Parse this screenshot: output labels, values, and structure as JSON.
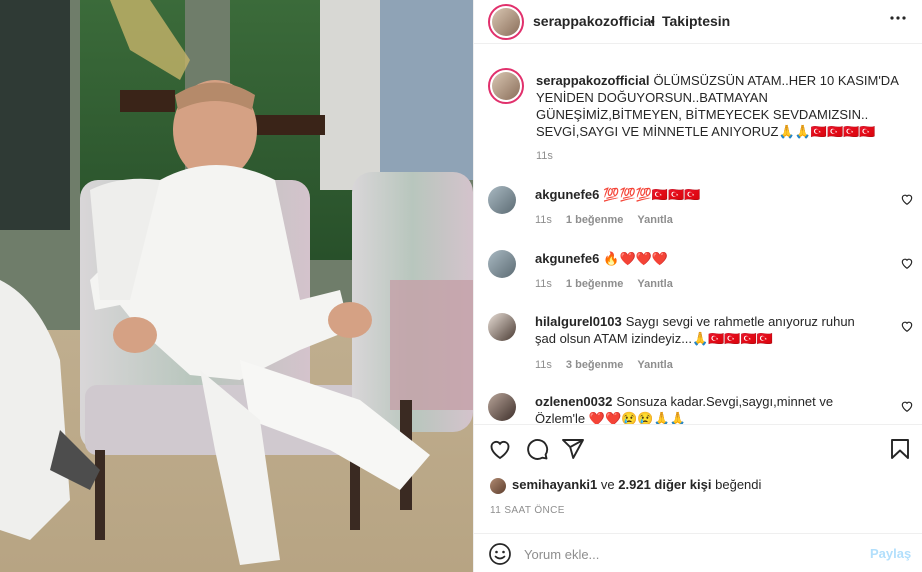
{
  "post": {
    "author": "serappakozofficial",
    "follow_status": "Takiptesin",
    "separator": "•",
    "caption": {
      "username": "serappakozofficial",
      "text": "ÖLÜMSÜZSÜN ATAM..HER 10 KASIM'DA YENİDEN DOĞUYORSUN..BATMAYAN GÜNEŞİMİZ,BİTMEYEN, BİTMEYECEK SEVDAMIZSIN.. SEVGİ,SAYGI VE MİNNETLE ANIYORUZ🙏🙏🇹🇷🇹🇷🇹🇷🇹🇷",
      "time": "11s"
    },
    "comments": [
      {
        "username": "akgunefe6",
        "text": "💯💯💯🇹🇷🇹🇷🇹🇷",
        "time": "11s",
        "likes": "1 beğenme",
        "reply": "Yanıtla"
      },
      {
        "username": "akgunefe6",
        "text": "🔥❤️❤️❤️",
        "time": "11s",
        "likes": "1 beğenme",
        "reply": "Yanıtla"
      },
      {
        "username": "hilalgurel0103",
        "text": "Saygı sevgi ve rahmetle anıyoruz ruhun şad olsun ATAM izindeyiz...🙏🇹🇷🇹🇷🇹🇷🇹🇷",
        "time": "11s",
        "likes": "3 beğenme",
        "reply": "Yanıtla"
      },
      {
        "username": "ozlenen0032",
        "text": "Sonsuza kadar.Sevgi,saygı,minnet ve Özlem'le ❤️❤️😢😢🙏🙏",
        "time": "",
        "likes": "",
        "reply": ""
      }
    ],
    "likes_line": {
      "liker": "semihayanki1",
      "connector": "ve",
      "others": "2.921 diğer kişi",
      "suffix": "beğendi"
    },
    "timestamp": "11 SAAT ÖNCE",
    "add_comment": {
      "placeholder": "Yorum ekle...",
      "post_label": "Paylaş"
    }
  },
  "icons": {
    "more": "more-horizontal-icon",
    "like": "heart-icon",
    "comment": "comment-icon",
    "share": "paper-plane-icon",
    "save": "bookmark-icon",
    "emoji": "smiley-icon"
  },
  "colors": {
    "text": "#262626",
    "secondary": "#8e8e8e",
    "border": "#efefef",
    "post_button_disabled": "#b2dffc",
    "story_ring": "#e1306c"
  }
}
